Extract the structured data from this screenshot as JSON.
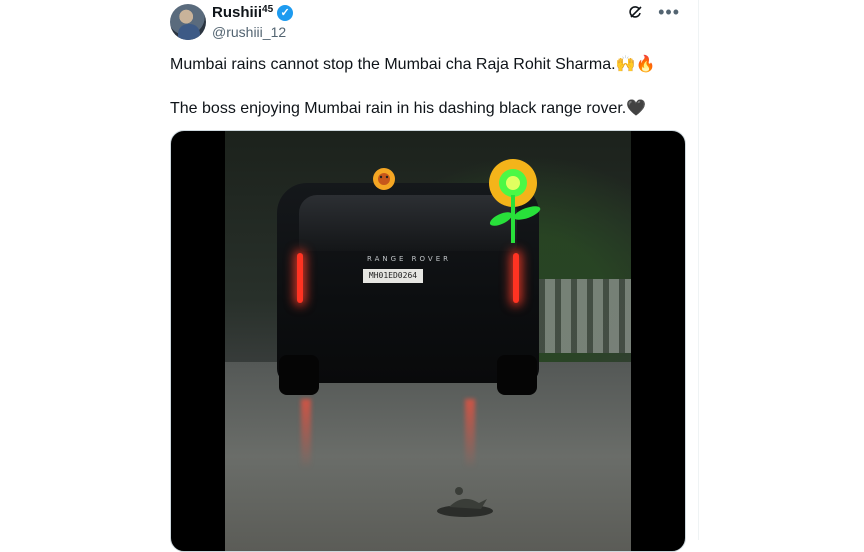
{
  "tweet": {
    "display_name": "Rushiii",
    "name_superscript": "45",
    "verified_mark": "✓",
    "handle": "@rushiii_12",
    "line1": "Mumbai rains cannot stop the Mumbai cha Raja Rohit Sharma.🙌🔥",
    "line2": "The boss enjoying Mumbai rain in his dashing black range rover.🖤",
    "more_label": "•••"
  },
  "media": {
    "car_brand": "RANGE ROVER",
    "plate": "MH01ED0264"
  },
  "icons": {
    "grok": "grok-icon",
    "more": "more-icon",
    "verified": "verified-badge-icon"
  },
  "colors": {
    "accent": "#1d9bf0",
    "text": "#0f1419",
    "muted": "#536471"
  }
}
